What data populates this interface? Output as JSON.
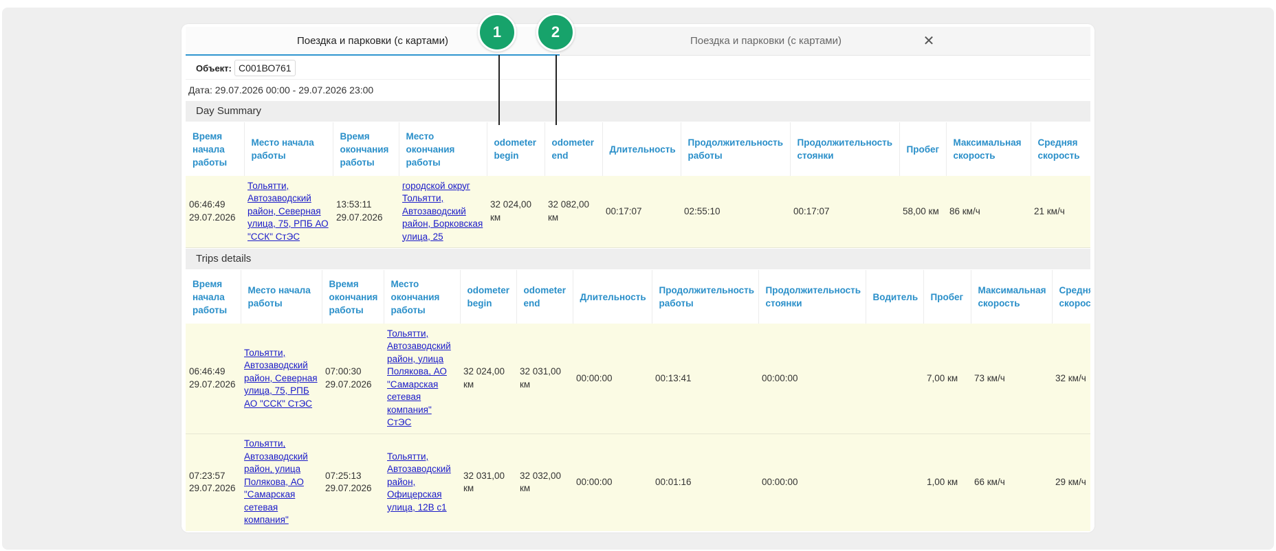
{
  "tabs": {
    "active_label": "Поездка и парковки (с картами)",
    "inactive_label": "Поездка и парковки (с картами)",
    "close_glyph": "✕"
  },
  "object": {
    "label": "Объект:",
    "value": "С001ВО761"
  },
  "date": "Дата: 29.07.2026 00:00 - 29.07.2026 23:00",
  "callouts": [
    "1",
    "2"
  ],
  "colors": {
    "accent": "#2a8fc9",
    "link": "#1a1ac9",
    "row_bg": "#fbfbe4",
    "callout": "#17a36b"
  },
  "day_summary": {
    "title": "Day Summary",
    "headers": [
      "Время начала работы",
      "Место начала работы",
      "Время окончания работы",
      "Место окончания работы",
      "odometer begin",
      "odometer end",
      "Длительность",
      "Продолжительность работы",
      "Продолжительность стоянки",
      "Пробег",
      "Максимальная скорость",
      "Средняя скорость"
    ],
    "row": {
      "start_time": "06:46:49 29.07.2026",
      "start_place": "Тольятти, Автозаводский район, Северная улица, 75, РПБ АО \"ССК\" СтЭС",
      "end_time": "13:53:11 29.07.2026",
      "end_place": "городской округ Тольятти, Автозаводский район, Борковская улица, 25",
      "odo_begin": "32 024,00 км",
      "odo_end": "32 082,00 км",
      "duration": "00:17:07",
      "work_duration": "02:55:10",
      "parking_duration": "00:17:07",
      "mileage": "58,00 км",
      "max_speed": "86 км/ч",
      "avg_speed": "21 км/ч"
    }
  },
  "trips": {
    "title": "Trips details",
    "headers": [
      "Время начала работы",
      "Место начала работы",
      "Время окончания работы",
      "Место окончания работы",
      "odometer begin",
      "odometer end",
      "Длительность",
      "Продолжительность работы",
      "Продолжительность стоянки",
      "Водитель",
      "Пробег",
      "Максимальная скорость",
      "Средняя скорость"
    ],
    "rows": [
      {
        "start_time": "06:46:49 29.07.2026",
        "start_place": "Тольятти, Автозаводский район, Северная улица, 75, РПБ АО \"ССК\" СтЭС",
        "end_time": "07:00:30 29.07.2026",
        "end_place": "Тольятти, Автозаводский район, улица Полякова, АО \"Самарская сетевая компания\" СтЭС",
        "odo_begin": "32 024,00 км",
        "odo_end": "32 031,00 км",
        "duration": "00:00:00",
        "work_duration": "00:13:41",
        "parking_duration": "00:00:00",
        "driver": "",
        "mileage": "7,00 км",
        "max_speed": "73 км/ч",
        "avg_speed": "32 км/ч"
      },
      {
        "start_time": "07:23:57 29.07.2026",
        "start_place": "Тольятти, Автозаводский район, улица Полякова, АО \"Самарская сетевая компания\"",
        "end_time": "07:25:13 29.07.2026",
        "end_place": "Тольятти, Автозаводский район, Офицерская улица, 12В с1",
        "odo_begin": "32 031,00 км",
        "odo_end": "32 032,00 км",
        "duration": "00:00:00",
        "work_duration": "00:01:16",
        "parking_duration": "00:00:00",
        "driver": "",
        "mileage": "1,00 км",
        "max_speed": "66 км/ч",
        "avg_speed": "29 км/ч"
      }
    ]
  }
}
